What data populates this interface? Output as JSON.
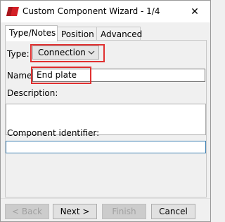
{
  "window": {
    "title": "Custom Component Wizard - 1/4",
    "close_glyph": "✕"
  },
  "tabs": [
    {
      "label": "Type/Notes",
      "active": true
    },
    {
      "label": "Position",
      "active": false
    },
    {
      "label": "Advanced",
      "active": false
    }
  ],
  "form": {
    "type_label": "Type:",
    "type_value": "Connection",
    "name_label": "Name:",
    "name_value": "End plate",
    "description_label": "Description:",
    "description_value": "",
    "identifier_label": "Component identifier:",
    "identifier_value": ""
  },
  "buttons": {
    "back": "< Back",
    "next": "Next >",
    "finish": "Finish",
    "cancel": "Cancel"
  },
  "colors": {
    "highlight": "#e03030",
    "brand_icon": "#d42027"
  }
}
